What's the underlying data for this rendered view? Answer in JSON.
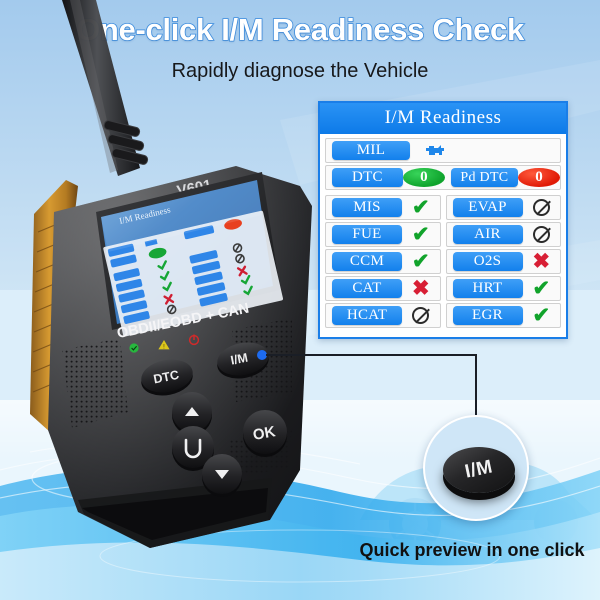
{
  "header": {
    "title": "One-click I/M Readiness Check",
    "subtitle": "Rapidly diagnose the Vehicle",
    "title_color": "#ffffff",
    "title_outline_color": "#3f8fe0"
  },
  "im_readiness": {
    "header": "I/M Readiness",
    "status_rows": [
      {
        "label": "MIL",
        "status": "engine-icon",
        "value": ""
      },
      {
        "label": "DTC",
        "status": "ellipse-green",
        "value": "0"
      },
      {
        "label": "Pd DTC",
        "status": "ellipse-red",
        "value": "0"
      }
    ],
    "monitors_left": [
      {
        "label": "MIS",
        "status": "check"
      },
      {
        "label": "FUE",
        "status": "check"
      },
      {
        "label": "CCM",
        "status": "check"
      },
      {
        "label": "CAT",
        "status": "cross"
      },
      {
        "label": "HCAT",
        "status": "na"
      }
    ],
    "monitors_right": [
      {
        "label": "EVAP",
        "status": "na"
      },
      {
        "label": "AIR",
        "status": "na"
      },
      {
        "label": "O2S",
        "status": "cross"
      },
      {
        "label": "HRT",
        "status": "check"
      },
      {
        "label": "EGR",
        "status": "check"
      }
    ],
    "glyphs": {
      "check": "✔",
      "cross": "✖"
    },
    "colors": {
      "check": "#11a32b",
      "cross": "#d81f35",
      "na": "#2b2b2b",
      "pill": "#1280ec",
      "header_bg": "#0d7ae8"
    }
  },
  "device": {
    "model": "V601",
    "protocol_label": "OBDII/EOBD + CAN",
    "screen_title": "I/M Readiness",
    "leds": [
      {
        "name": "status-ok-led",
        "color": "#2ecc40"
      },
      {
        "name": "warning-led",
        "color": "#d8c319"
      },
      {
        "name": "power-led",
        "color": "#d42a2a"
      }
    ],
    "buttons": [
      {
        "name": "dtc-button",
        "label": "DTC"
      },
      {
        "name": "im-button",
        "label": "I/M"
      },
      {
        "name": "up-button",
        "label": "▲"
      },
      {
        "name": "ok-button",
        "label": "OK"
      },
      {
        "name": "back-button",
        "label": "↶"
      },
      {
        "name": "down-button",
        "label": "▼"
      }
    ]
  },
  "callout": {
    "button_label": "I/M",
    "caption": "Quick preview in one click"
  }
}
